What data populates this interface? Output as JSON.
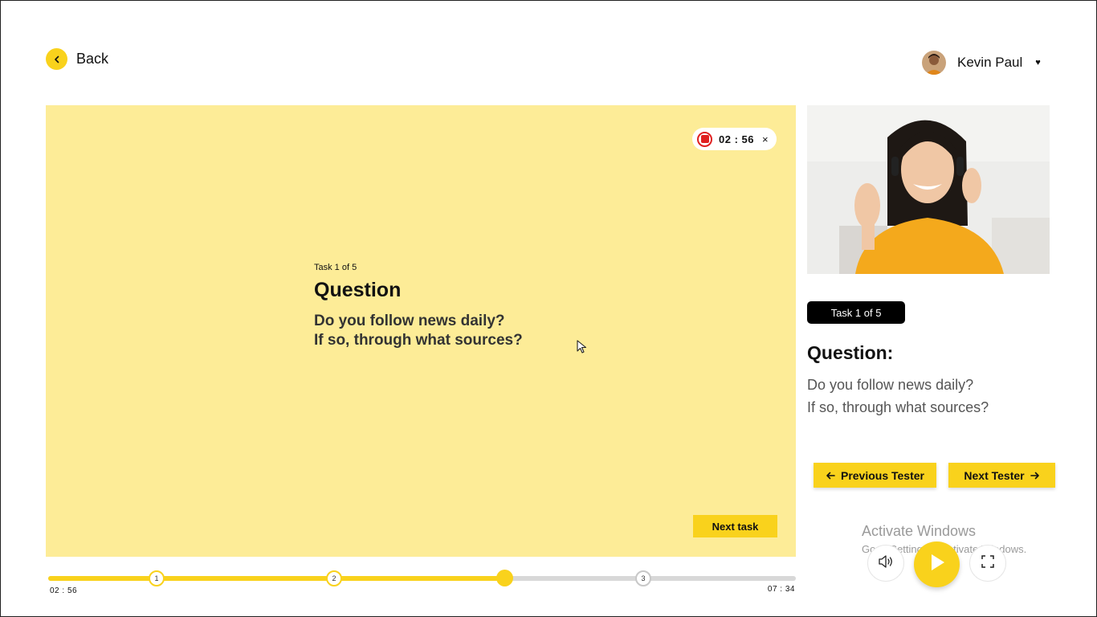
{
  "header": {
    "back_label": "Back",
    "user_name": "Kevin Paul",
    "user_caret": "♥"
  },
  "recording": {
    "time": "02 : 56",
    "close": "×"
  },
  "stage": {
    "task_label": "Task 1 of 5",
    "question_title": "Question",
    "question_line1": "Do you follow news daily?",
    "question_line2": "If so, through what sources?",
    "next_task_label": "Next task"
  },
  "timeline": {
    "elapsed": "02 : 56",
    "total": "07 : 34",
    "progress_fraction": 0.61,
    "markers": [
      "1",
      "2",
      "3"
    ]
  },
  "panel": {
    "task_badge": "Task 1 of 5",
    "question_title": "Question:",
    "question_line1": "Do you follow news daily?",
    "question_line2": "If so, through what sources?",
    "prev_label": "Previous Tester",
    "next_label": "Next Tester"
  },
  "watermark": {
    "title": "Activate Windows",
    "subtitle": "Go to Settings to activate Windows."
  },
  "colors": {
    "accent": "#f9d21c",
    "stage_bg": "#fdec97",
    "record": "#e02020"
  }
}
